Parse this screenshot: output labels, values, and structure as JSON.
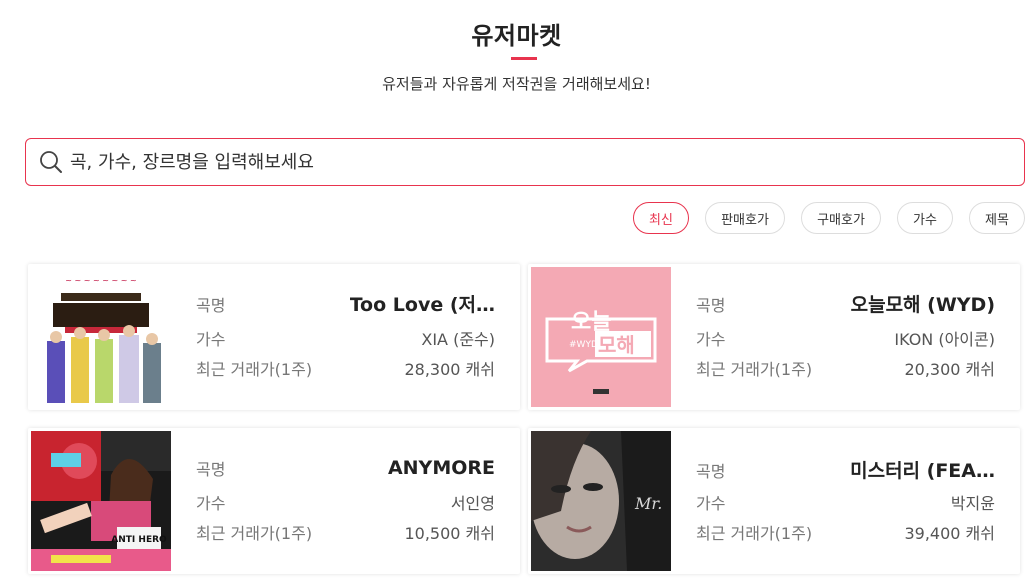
{
  "header": {
    "title": "유저마켓",
    "subtitle": "유저들과 자유롭게 저작권을 거래해보세요!"
  },
  "search": {
    "placeholder": "곡, 가수, 장르명을 입력해보세요"
  },
  "filters": [
    {
      "label": "최신",
      "active": true
    },
    {
      "label": "판매호가",
      "active": false
    },
    {
      "label": "구매호가",
      "active": false
    },
    {
      "label": "가수",
      "active": false
    },
    {
      "label": "제목",
      "active": false
    }
  ],
  "labels": {
    "song": "곡명",
    "artist": "가수",
    "recent_price": "최근 거래가(1주)"
  },
  "cards": [
    {
      "title": "Too Love (저…",
      "artist": "XIA (준수)",
      "price": "28,300 캐쉬"
    },
    {
      "title": "오늘모해 (WYD)",
      "artist": "IKON (아이콘)",
      "price": "20,300 캐쉬"
    },
    {
      "title": "ANYMORE",
      "artist": "서인영",
      "price": "10,500 캐쉬"
    },
    {
      "title": "미스터리 (FEA…",
      "artist": "박지윤",
      "price": "39,400 캐쉬"
    }
  ],
  "artwork": {
    "card2_logo_top": "오늘",
    "card2_logo_bottom": "모해",
    "card2_tag": "#WYD",
    "card3_text": "ANTI HERO",
    "card4_text": "Mr."
  },
  "colors": {
    "accent": "#e8344e",
    "card2_bg": "#f4a9b4"
  }
}
